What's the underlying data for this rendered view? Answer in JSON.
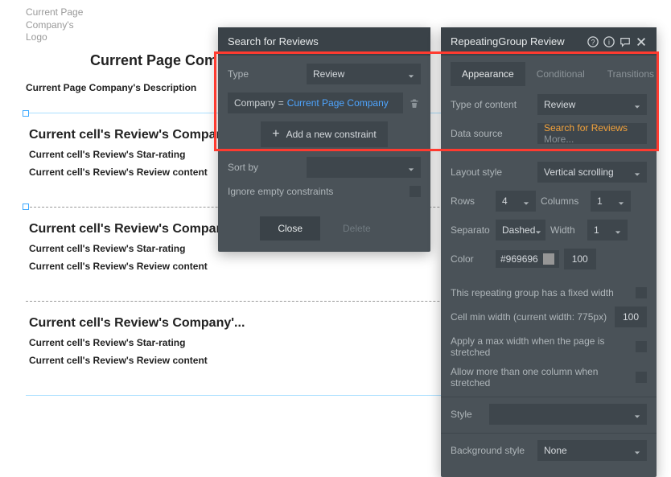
{
  "canvas": {
    "logo_text": "Current Page\nCompany's\nLogo",
    "page_title": "Current Page Company's Name",
    "page_desc": "Current Page Company's Description",
    "cells": [
      {
        "company": "Current cell's Review's Company'...",
        "stars": "Current cell's Review's Star-rating",
        "content": "Current cell's Review's Review content"
      },
      {
        "company": "Current cell's Review's Company'...",
        "stars": "Current cell's Review's Star-rating",
        "content": "Current cell's Review's Review content"
      },
      {
        "company": "Current cell's Review's Company'...",
        "stars": "Current cell's Review's Star-rating",
        "content": "Current cell's Review's Review content"
      }
    ]
  },
  "searchPanel": {
    "title": "Search for Reviews",
    "type_label": "Type",
    "type_value": "Review",
    "constraint_field": "Company =",
    "constraint_value": "Current Page Company",
    "add_constraint": "Add a new constraint",
    "sort_label": "Sort by",
    "ignore_label": "Ignore empty constraints",
    "close": "Close",
    "delete": "Delete"
  },
  "rgPanel": {
    "title": "RepeatingGroup Review",
    "tabs": {
      "appearance": "Appearance",
      "conditional": "Conditional",
      "transitions": "Transitions"
    },
    "type_content_label": "Type of content",
    "type_content_value": "Review",
    "datasource_label": "Data source",
    "datasource_value": "Search for Reviews",
    "datasource_more": "More...",
    "layout_label": "Layout style",
    "layout_value": "Vertical scrolling",
    "rows_label": "Rows",
    "rows_value": "4",
    "columns_label": "Columns",
    "columns_value": "1",
    "separator_label": "Separato",
    "separator_value": "Dashed",
    "width_label": "Width",
    "width_value": "1",
    "color_label": "Color",
    "color_value": "#969696",
    "color_opacity": "100",
    "fixed_width_label": "This repeating group has a fixed width",
    "min_width_label": "Cell min width (current width: 775px)",
    "min_width_value": "100",
    "max_width_label": "Apply a max width when the page is stretched",
    "multi_col_label": "Allow more than one column when stretched",
    "style_label": "Style",
    "bg_label": "Background style",
    "bg_value": "None"
  }
}
